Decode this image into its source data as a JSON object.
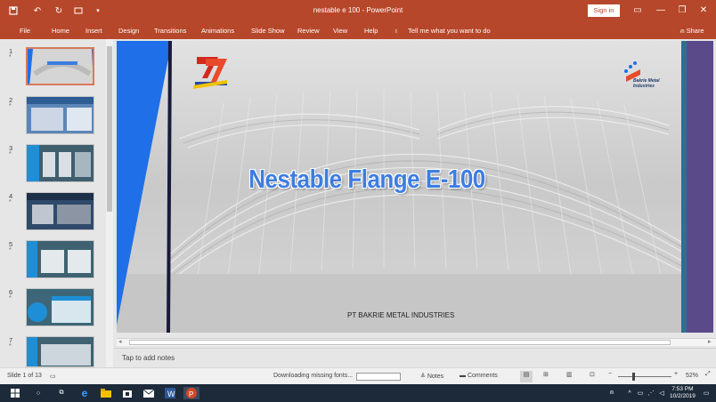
{
  "window": {
    "title": "nestable e 100  -  PowerPoint",
    "sign_in": "Sign in"
  },
  "ribbon": {
    "tabs": [
      "File",
      "Home",
      "Insert",
      "Design",
      "Transitions",
      "Animations",
      "Slide Show",
      "Review",
      "View",
      "Help"
    ],
    "tell_me": "Tell me what you want to do",
    "share": "Share"
  },
  "thumbnails": [
    {
      "num": "1",
      "star": "*"
    },
    {
      "num": "2",
      "star": "*"
    },
    {
      "num": "3",
      "star": "*"
    },
    {
      "num": "4",
      "star": "*"
    },
    {
      "num": "5",
      "star": "*"
    },
    {
      "num": "6",
      "star": "*"
    },
    {
      "num": "7",
      "star": "*"
    }
  ],
  "slide": {
    "title": "Nestable Flange E-100",
    "footer": "PT BAKRIE METAL INDUSTRIES",
    "logo_right_text": "Bakrie Metal Industries"
  },
  "notes": {
    "placeholder": "Tap to add notes"
  },
  "status": {
    "slide_info": "Slide 1 of 13",
    "downloading": "Downloading missing fonts...",
    "notes": "Notes",
    "comments": "Comments",
    "zoom": "52%"
  },
  "taskbar": {
    "time": "7:53 PM",
    "date": "10/2/2019"
  },
  "colors": {
    "accent": "#b7472a",
    "slide_title": "#3d7de0",
    "selection": "#d9785b",
    "slide_left_band": "#1f6fe8",
    "slide_right_band": "#5b4a8a"
  }
}
